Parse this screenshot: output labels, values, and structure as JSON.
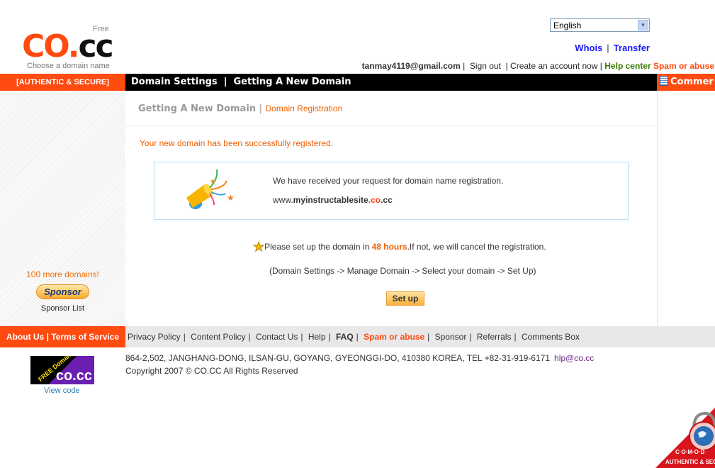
{
  "header": {
    "logo_free": "Free",
    "logo_co": "CO.",
    "logo_cc": "cc",
    "logo_tagline": "Choose a domain name",
    "language": "English",
    "whois": "Whois",
    "transfer": "Transfer",
    "account_email": "tanmay4119@gmail.com",
    "sign_out": "Sign out",
    "create_account": "Create an account now",
    "help_center": "Help center",
    "spam": "Spam or abuse"
  },
  "nav": {
    "badge": "[AUTHENTIC & SECURE]",
    "domain_settings": "Domain Settings",
    "sep": "|",
    "new_domain": "Getting A New Domain",
    "comments": "Commer"
  },
  "main": {
    "breadcrumb_parent": "Getting A New Domain",
    "breadcrumb_sep": "|",
    "breadcrumb_current": "Domain Registration",
    "success": "Your new domain has been successfully registered.",
    "received": "We have received your request for domain name registration.",
    "domain_prefix": "www.",
    "domain_name": "myinstructablesite",
    "domain_co": ".co",
    "domain_cc": ".cc",
    "notice_pre": "Please set up the domain in ",
    "notice_hours": "48 hours",
    "notice_post": ".If not, we will cancel the registration.",
    "instructions": "(Domain Settings -> Manage Domain -> Select your domain -> Set Up)",
    "setup_button": "Set up"
  },
  "sidebar": {
    "more_domains": "100 more domains!",
    "sponsor_button": "Sponsor",
    "sponsor_list": "Sponsor List"
  },
  "footer": {
    "about": "About Us",
    "terms": "Terms of Service",
    "links": [
      "Privacy Policy",
      "Content Policy",
      "Contact Us",
      "Help",
      "FAQ",
      "Spam or abuse",
      "Sponsor",
      "Referrals",
      "Comments Box"
    ],
    "badge_text": "FREE Domain DNS",
    "badge_brand": "co.cc",
    "view_code": "View code",
    "address": "864-2,502, JANGHANG-DONG, ILSAN-GU, GOYANG, GYEONGGI-DO, 410380 KOREA, TEL +82-31-919-6171",
    "email": "hlp@co.cc",
    "copyright": "Copyright 2007 © CO.CC All Rights Reserved",
    "comodo": "C·O·M·O·D",
    "comodo_sub": "AUTHENTIC & SECU"
  }
}
